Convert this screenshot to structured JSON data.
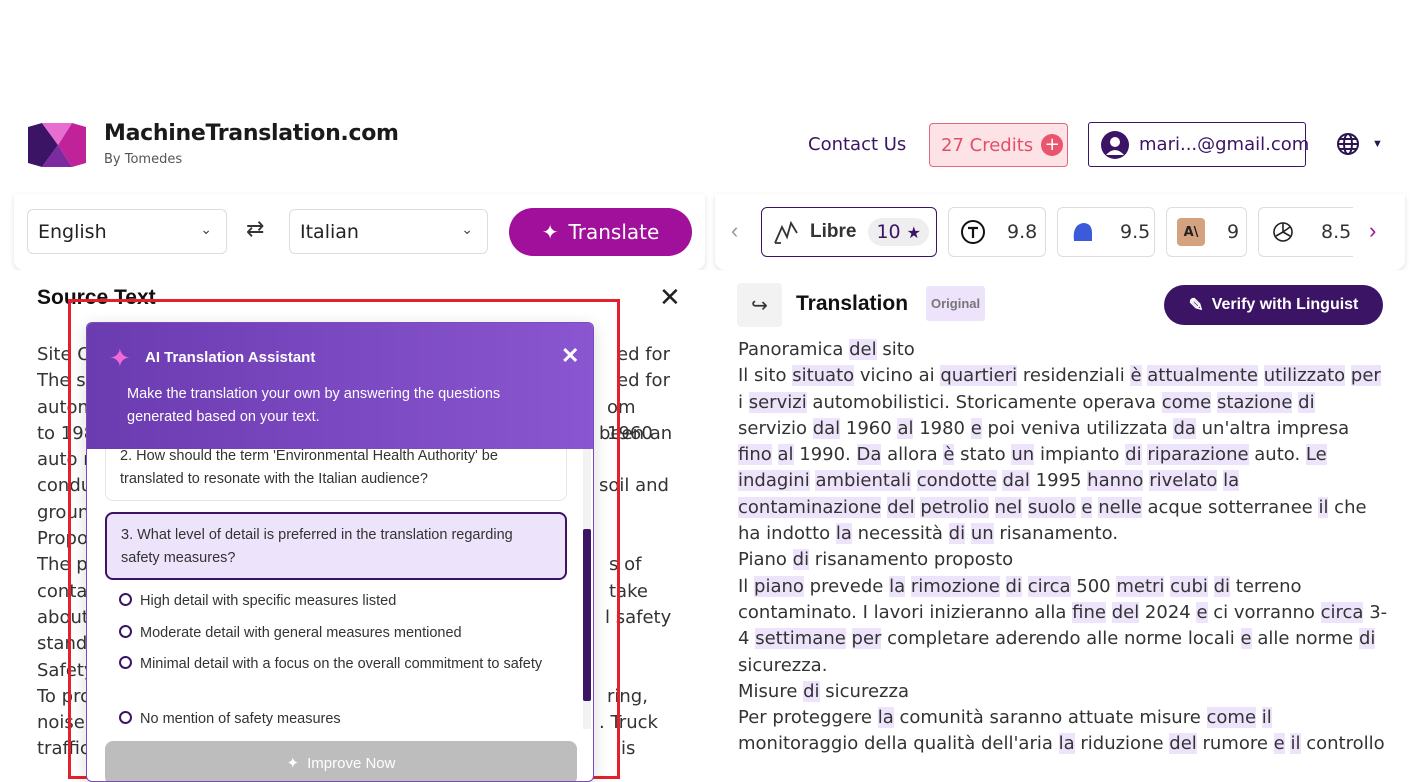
{
  "brand": {
    "title": "MachineTranslation.com",
    "subtitle": "By Tomedes"
  },
  "header": {
    "contact": "Contact Us",
    "credits": "27 Credits",
    "account": "mari...@gmail.com",
    "language_icon": "globe-icon"
  },
  "languages": {
    "source": "English",
    "target": "Italian",
    "translate_label": "Translate"
  },
  "engines": [
    {
      "name": "Libre",
      "score": "10",
      "icon": "libre-icon",
      "active": true
    },
    {
      "name": "",
      "score": "9.8",
      "icon": "t-circle-icon"
    },
    {
      "name": "",
      "score": "9.5",
      "icon": "blue-blob-icon"
    },
    {
      "name": "",
      "score": "9",
      "icon": "anthropic-icon"
    },
    {
      "name": "",
      "score": "8.5",
      "icon": "openai-icon"
    }
  ],
  "source": {
    "title": "Source Text",
    "lines": [
      "Site O",
      "The si",
      "autom",
      "to 198",
      "auto r",
      "condu",
      "groun",
      "Propo",
      "The p",
      "conta",
      "about",
      "stand",
      "Safety",
      "To pro",
      "noise",
      "traffic"
    ],
    "right_fragments": [
      "ed for",
      "om 1960",
      "been an",
      "",
      "soil and",
      "",
      "",
      "",
      "s of",
      "take",
      "l safety",
      "",
      "",
      "ring,",
      ". Truck",
      "is"
    ]
  },
  "assistant": {
    "title": "AI Translation Assistant",
    "description": "Make the translation your own by answering the questions generated based on your text.",
    "q2": "2. How should the term 'Environmental Health Authority' be translated to resonate with the Italian audience?",
    "q3": "3. What level of detail is preferred in the translation regarding safety measures?",
    "options": [
      "High detail with specific measures listed",
      "Moderate detail with general measures mentioned",
      "Minimal detail with a focus on the overall commitment to safety",
      "No mention of safety measures"
    ],
    "improve_label": "Improve Now"
  },
  "translation": {
    "title": "Translation",
    "badge": "Original",
    "verify_label": "Verify with Linguist"
  }
}
